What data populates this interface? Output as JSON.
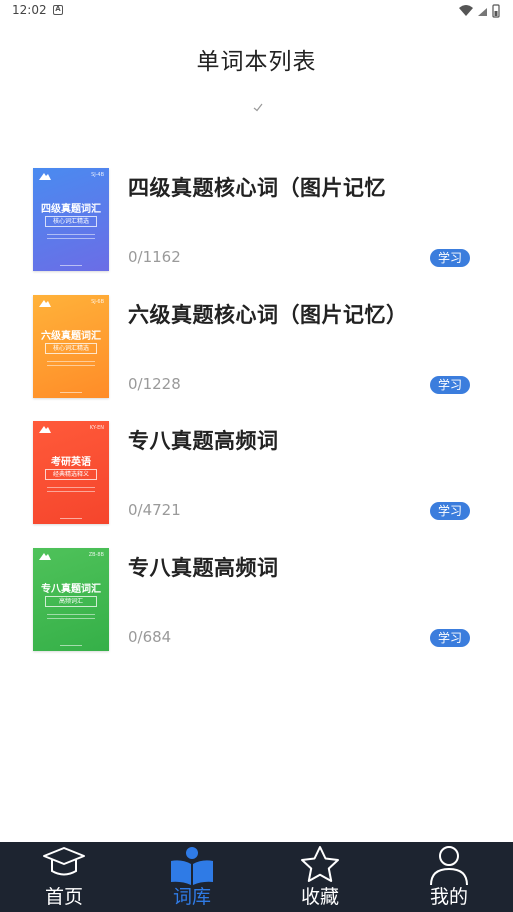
{
  "status_bar": {
    "time": "12:02",
    "notification_glyph": "A"
  },
  "header": {
    "title": "单词本列表"
  },
  "books": [
    {
      "name": "四级真题核心词（图片记忆",
      "progress": "0/1162",
      "action_label": "学习",
      "cover": {
        "tag": "SJ-4B",
        "title": "四级真题词汇",
        "subtitle": "核心词汇精选",
        "color_top": "#4a8bf0",
        "color_bottom": "#6b6de6"
      }
    },
    {
      "name": "六级真题核心词（图片记忆）",
      "progress": "0/1228",
      "action_label": "学习",
      "cover": {
        "tag": "SJ-6B",
        "title": "六级真题词汇",
        "subtitle": "核心词汇精选",
        "color_top": "#ffb23a",
        "color_bottom": "#ff8c28"
      }
    },
    {
      "name": "专八真题高频词",
      "progress": "0/4721",
      "action_label": "学习",
      "cover": {
        "tag": "KY-EN",
        "title": "考研英语",
        "subtitle": "经典精选释义",
        "color_top": "#ff5a3a",
        "color_bottom": "#f5452c"
      }
    },
    {
      "name": "专八真题高频词",
      "progress": "0/684",
      "action_label": "学习",
      "cover": {
        "tag": "ZB-8B",
        "title": "专八真题词汇",
        "subtitle": "高频词汇",
        "color_top": "#4fc25a",
        "color_bottom": "#35b048"
      }
    }
  ],
  "tabs": [
    {
      "label": "首页",
      "icon": "graduation-cap-icon",
      "active": false
    },
    {
      "label": "词库",
      "icon": "book-person-icon",
      "active": true
    },
    {
      "label": "收藏",
      "icon": "star-icon",
      "active": false
    },
    {
      "label": "我的",
      "icon": "user-icon",
      "active": false
    }
  ],
  "colors": {
    "accent": "#2f7be6",
    "study_button": "#3b7ddd",
    "tabbar_bg": "#1d2430"
  }
}
